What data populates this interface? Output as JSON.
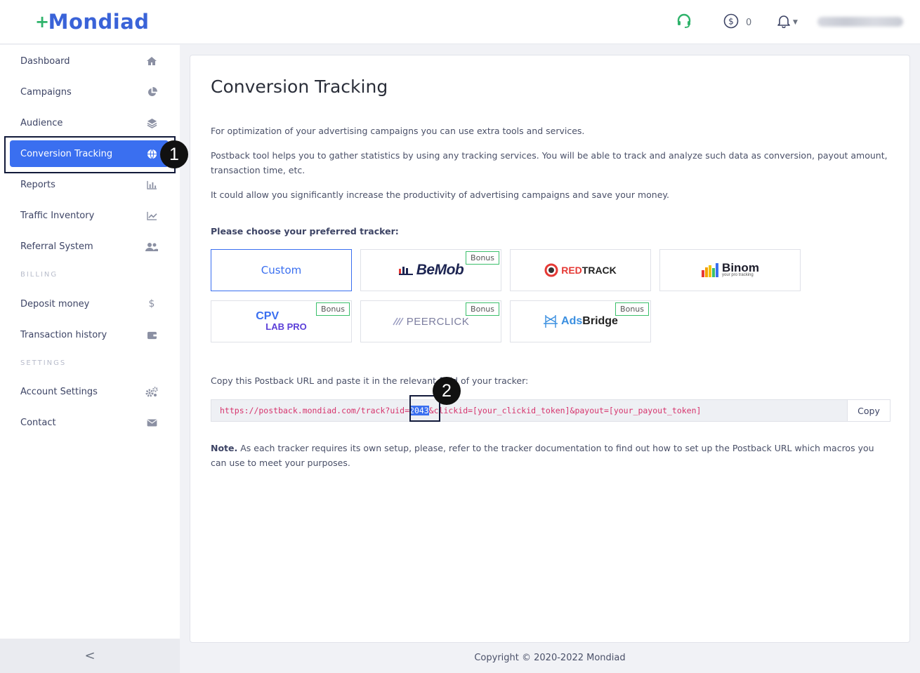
{
  "header": {
    "logo_text": "Mondiad",
    "logo_plus": "+",
    "balance": "0",
    "icons": [
      "headset-icon",
      "dollar-icon",
      "bell-icon",
      "caret-down-icon"
    ]
  },
  "sidebar": {
    "items": [
      {
        "label": "Dashboard",
        "icon": "home-icon"
      },
      {
        "label": "Campaigns",
        "icon": "pie-chart-icon"
      },
      {
        "label": "Audience",
        "icon": "layers-icon"
      },
      {
        "label": "Conversion Tracking",
        "icon": "globe-icon",
        "active": true
      },
      {
        "label": "Reports",
        "icon": "bar-chart-icon"
      },
      {
        "label": "Traffic Inventory",
        "icon": "line-chart-icon"
      },
      {
        "label": "Referral System",
        "icon": "users-icon"
      }
    ],
    "billing_label": "BILLING",
    "billing_items": [
      {
        "label": "Deposit money",
        "icon": "dollar-sign-icon"
      },
      {
        "label": "Transaction history",
        "icon": "wallet-icon"
      }
    ],
    "settings_label": "SETTINGS",
    "settings_items": [
      {
        "label": "Account Settings",
        "icon": "cogs-icon"
      },
      {
        "label": "Contact",
        "icon": "envelope-icon"
      }
    ],
    "collapse": "<"
  },
  "annotations": {
    "badge1": "1",
    "badge2": "2"
  },
  "main": {
    "title": "Conversion Tracking",
    "p1": "For optimization of your advertising campaigns you can use extra tools and services.",
    "p2": "Postback tool helps you to gather statistics by using any tracking services. You will be able to track and analyze such data as conversion, payout amount, transaction time, etc.",
    "p3": "It could allow you significantly increase the productivity of advertising campaigns and save your money.",
    "choose_label": "Please choose your preferred tracker:",
    "trackers": {
      "custom": "Custom",
      "bemob": "BeMob",
      "redtrack_red": "RED",
      "redtrack_rest": "TRACK",
      "binom": "Binom",
      "binom_sub": "your pro tracking",
      "cpv_top": "CPV",
      "cpv_bottom": "LAB PRO",
      "peerclick": "PEERCLICK",
      "adsbridge_ads": "Ads",
      "adsbridge_bridge": "Bridge",
      "bonus": "Bonus"
    },
    "copy_label": "Copy this Postback URL and paste it in the relevant field of your tracker:",
    "url_prefix": "https://postback.mondiad.com/track?uid=",
    "url_uid": "2043",
    "url_suffix": "&clickid=[your_clickid_token]&payout=[your_payout_token]",
    "copy_button": "Copy",
    "note_bold": "Note.",
    "note_text": " As each tracker requires its own setup, please, refer to the tracker documentation to find out how to set up the Postback URL which macros you can use to meet your purposes."
  },
  "footer": {
    "copyright": "Copyright © 2020-2022 Mondiad"
  }
}
